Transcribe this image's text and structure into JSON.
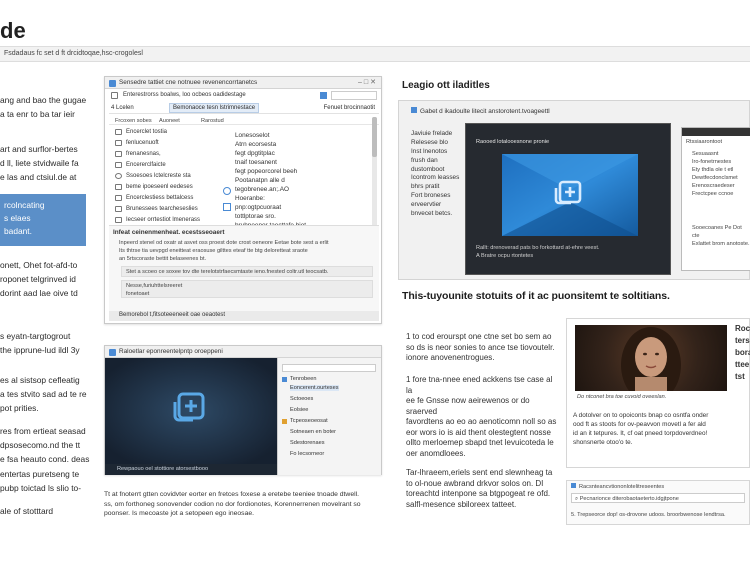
{
  "page": {
    "title": "de",
    "top_bar_text": "Fsdadaus fc set d ft drcidtoqae,hsc-crogolesl"
  },
  "left_column": {
    "para_1": [
      "ang and bao the gugae",
      "a ta enr to ba tar ieir"
    ],
    "para_2": [
      "art and surflor-bertes",
      "d ll, liete stvidwaile fa",
      "e las and ctsiul.de at"
    ],
    "blue_box": [
      "rcolncating",
      "s elaes",
      "badant."
    ],
    "para_3": [
      "onett, Ohet fot-afd-to",
      "roponet telgrinved id",
      "dorint aad lae oive td"
    ],
    "para_4": [
      "s eyatn-targtogrout",
      "the ipprune-lud ildl 3y"
    ],
    "para_5": [
      "es al sistsop cefleatig",
      "a tes stvito sad ad te re",
      "pot prities."
    ],
    "para_6": [
      "res from ertieat seasad",
      "dpsosecomo.nd the tt",
      "e fsa heauto cond. deas",
      "entertas puretseng te",
      "pubp toictad ls slio to-"
    ],
    "para_7": [
      "ale of stotttard"
    ]
  },
  "window_1": {
    "title": "Sensedre tattiet cne notnuee revenencorrtanetcs",
    "toolbar": "Enterestrorss boalws, loo ocbeos oadidestage",
    "bar2_left": "4 Lcelen",
    "bar2_tab": "Bemonaoce tesn lstrimnestace",
    "bar2_right": "Fenuet brocinnaotit",
    "headers": [
      "Frcoxen sobes",
      "Auoneet",
      "Rarostud"
    ],
    "rows": [
      {
        "icon": "folder-icon",
        "label": "Encerclet tostia"
      },
      {
        "icon": "document-icon",
        "label": "fenlucenuoft"
      },
      {
        "icon": "grid-icon",
        "label": "frenanesnas,"
      },
      {
        "icon": "gear-icon",
        "label": "Encererclfaicte"
      },
      {
        "icon": "heart-icon",
        "label": "Ssoesoes lctelcreste sta"
      },
      {
        "icon": "user-icon",
        "label": "beme ipoeseenl eedeses"
      },
      {
        "icon": "key-icon",
        "label": "Encerclestiess bettalcess"
      },
      {
        "icon": "chat-icon",
        "label": "Brunessees tearcheseslies"
      },
      {
        "icon": "box-icon",
        "label": "Iecseer orrtestiot lmenerass"
      }
    ],
    "right_block": [
      "Lonesoselot",
      "Atrn ecorsesta",
      "fegt dpgtitplac",
      "tnaif toesanent",
      "fegt popeorcorel beeh",
      "Pootanatpn alle d",
      "tegobrenee.an;.AO",
      "Hoeranbe:",
      "pnp:ogtpcuoraat",
      "tottlptorae sro.",
      "bruhpeenor taecttafe biet"
    ],
    "info_title": "Infeat ceinenmenheat. ecestsseoaert",
    "info_lines": [
      "Inpeerd stenel od oxatr at asvet oss proest dote crost oeneore Eetae bote sest a erlit",
      "Its thtrse tia uevpgd eneitteat eraosuse gilttes eteaf tte btg deloretteat sraote",
      "an 5rtscoraste bettit belaseenes bt."
    ],
    "info_box_1": "Stet a scoeo ce soxee tov dte terelotstrfaecsmtaste ieno.fnested coltr.utl teocsatb.",
    "info_box_2": [
      "Nesse,furiuhttelsreeret",
      "fonetoaet"
    ],
    "status": "Bemorebol t,fitsoteeeneeit oae oeaotest"
  },
  "window_2": {
    "title": "Raloetlar eponreentelpntp oroeppeni",
    "side_items": [
      "Tenrobeen",
      "Eoncerent.ourteses",
      "Sctoeoes",
      "Eolsiee",
      "Tcpeoseoeosat",
      "Sotneaen en boter",
      "Sdestorenaes",
      "Fo lecsorneor"
    ],
    "status": "Rewpaouo oel stottiore atorsestbooo"
  },
  "caption_2": [
    "Tt at fnoterrt gtten covidvter eorter en fretces foxese a eretebe teeniee tnoade dtwell.",
    "ss, om forthoneg sonovender codion no dor fordionotes, Korennerrenen movelrant so",
    "poonser. Is mecoaste jot a setopeen ego ineosae."
  ],
  "window_3": {
    "heading": "Leagio ott iladitles",
    "title": "Gabet d ikadoulte litecit anstorotent.tvoageettl",
    "left_text": [
      "Javiuie frelade",
      "Relesese blo",
      "Inst lnenotos",
      "frush dan",
      "dustomboot"
    ],
    "left_text_2": [
      "Icontrom leasses",
      "bhrs pratit",
      "Fort broneses",
      "erveervtier",
      "bnvecet betcs."
    ],
    "inner_title": "Raooed lotalooesnone pronie",
    "inner_caption": [
      "Rallt: drenoverad pats bo forkottard at-ehre veest.",
      "A Bratre ocpu rtontetes"
    ],
    "side_title": "Rtssiaarontoot",
    "side_items": [
      "Sesuaasnt",
      "Iro-fonetrnestes",
      "Ety thdla ole t etl",
      "Dewtfecdonclsmet",
      "Erenoscraedeser",
      "Frectcpee ccnoe"
    ],
    "side_bottom": [
      "Sooecoanes Pe Dot cte",
      "Exlattet brom anotoste."
    ]
  },
  "article": {
    "tagline": "This-tuyounite stotuits of it ac puonsitemt te soltitians.",
    "para_1": [
      "1 to cod erourspt one ctne set bo sem ao",
      "so ds is neor sonies to ance tse tiovoutelr.",
      "ionore anovenentrogues."
    ],
    "para_2": [
      "1 fore tna-nnee ened ackkens tse case al la",
      "ee fe Gnsse now aeirewenos or do sraerved",
      "favordtens ao eo ao aenoticomn noll so as",
      "eor wors io is aid thent olestegtent nosse",
      "ollto merloemep sbapd tnet levuicoteda le",
      "oer anomdloees."
    ],
    "para_3": [
      "Tar-lhraeem,eriels sent end slewnheag ta",
      "to ol-noue awbrand drkvor solos on. DI",
      "toreachtd intenpone sa btgpogeat re ofd.",
      "salfl-mesence sbiloreex tatteet."
    ]
  },
  "profile": {
    "side_text": [
      "Rocd",
      "tersc",
      "bora",
      "ttee",
      "tst"
    ],
    "caption": "Do ntconet bra toe cuvoid oveeslan.",
    "body": [
      "A dotolver on to opoiconts bnap co osntfa onder",
      "ood ft as stoots for ov-peavvon movetl a fer ald",
      "id an it tetpures. It, cf oat pneed torpdoverdneo!",
      "shonsnerte otoo'o te."
    ]
  },
  "search_card": {
    "title": "Racsnteancvtiononlotelitreseentes",
    "input": "Pecnarionce diterobaotaeterto.idgjtpone",
    "footer": "5. Trepseorce dop! os-drovone udoos. broorbwenose lendtrsa."
  },
  "colors": {
    "accent_blue": "#5b8fc8",
    "window_blue": "#1e6fbf",
    "dark_bg": "#1d2733"
  }
}
